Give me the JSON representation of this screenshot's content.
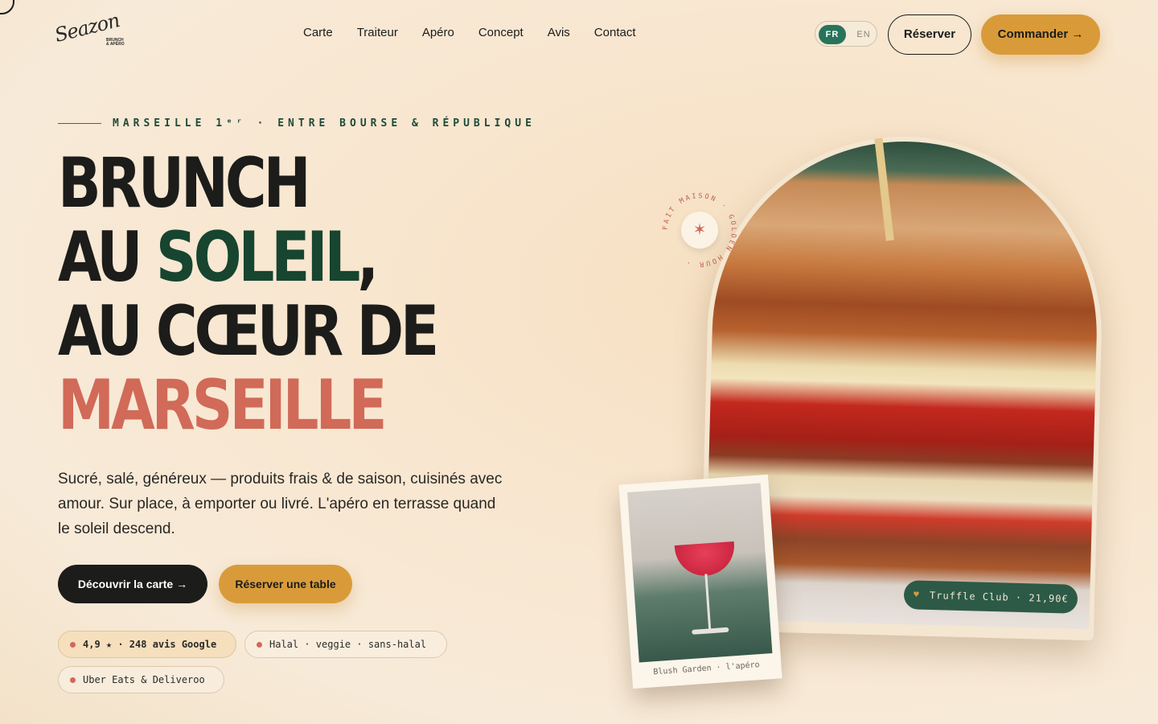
{
  "brand": {
    "script": "Seazon",
    "sub": "BRUNCH & APÉRO"
  },
  "nav": {
    "items": [
      "Carte",
      "Traiteur",
      "Apéro",
      "Concept",
      "Avis",
      "Contact"
    ]
  },
  "lang": {
    "active": "FR",
    "inactive": "EN"
  },
  "header": {
    "reserve_label": "Réserver",
    "order_label": "Commander →"
  },
  "hero": {
    "eyebrow": "MARSEILLE 1ᵉʳ · ENTRE BOURSE & RÉPUBLIQUE",
    "line1": "BRUNCH",
    "line2_a": "AU ",
    "line2_b": "SOLEIL",
    "line2_c": ",",
    "line3": "AU CŒUR DE",
    "line4": "MARSEILLE",
    "lead": "Sucré, salé, généreux — produits frais & de saison, cuisinés avec amour. Sur place, à emporter ou livré. L'apéro en terrasse quand le soleil descend.",
    "cta_primary": "Découvrir la carte →",
    "cta_secondary": "Réserver une table"
  },
  "chips": [
    "4,9 ★ · 248 avis Google",
    "Halal · veggie · sans-halal",
    "Uber Eats & Deliveroo"
  ],
  "badge": {
    "text": "FAIT MAISON · GOLDEN HOUR · "
  },
  "dish_tag": "Truffle Club · 21,90€",
  "polaroid_caption": "Blush Garden · l'apéro",
  "colors": {
    "green": "#27745a",
    "dark_green": "#17452f",
    "coral": "#d16a58",
    "gold": "#d99b3a"
  }
}
